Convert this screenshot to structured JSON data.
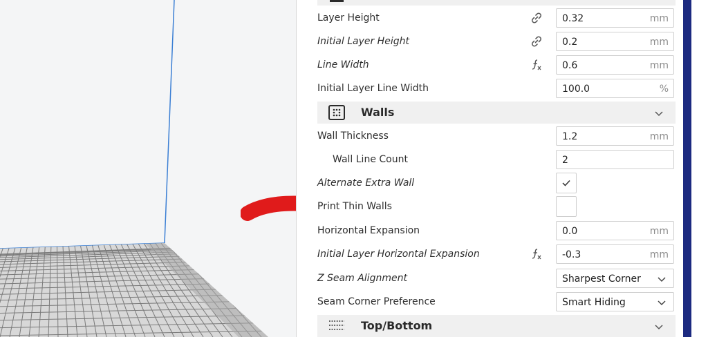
{
  "settings_panel": {
    "rows_top": [
      {
        "label": "Layer Height",
        "icon": "link-icon",
        "value": "0.32",
        "unit": "mm"
      },
      {
        "label": "Initial Layer Height",
        "icon": "link-icon",
        "value": "0.2",
        "unit": "mm"
      },
      {
        "label": "Line Width",
        "icon": "function-icon",
        "value": "0.6",
        "unit": "mm"
      },
      {
        "label": "Initial Layer Line Width",
        "value": "100.0",
        "unit": "%"
      }
    ],
    "walls_section": {
      "title": "Walls",
      "icon": "walls-grid-icon",
      "rows": [
        {
          "label": "Wall Thickness",
          "value": "1.2",
          "unit": "mm"
        },
        {
          "label": "Wall Line Count",
          "value": "2"
        },
        {
          "label": "Alternate Extra Wall",
          "checked": true
        },
        {
          "label": "Print Thin Walls",
          "checked": false
        },
        {
          "label": "Horizontal Expansion",
          "value": "0.0",
          "unit": "mm"
        },
        {
          "label": "Initial Layer Horizontal Expansion",
          "icon": "function-icon",
          "value": "-0.3",
          "unit": "mm"
        },
        {
          "label": "Z Seam Alignment",
          "selected": "Sharpest Corner"
        },
        {
          "label": "Seam Corner Preference",
          "selected": "Smart Hiding"
        }
      ]
    },
    "top_bottom_section": {
      "title": "Top/Bottom",
      "icon": "top-bottom-icon"
    }
  },
  "colors": {
    "accent_blue": "#3b7fd4",
    "sidebar_navy": "#1c2a80",
    "annotation_red": "#e01b1b"
  }
}
